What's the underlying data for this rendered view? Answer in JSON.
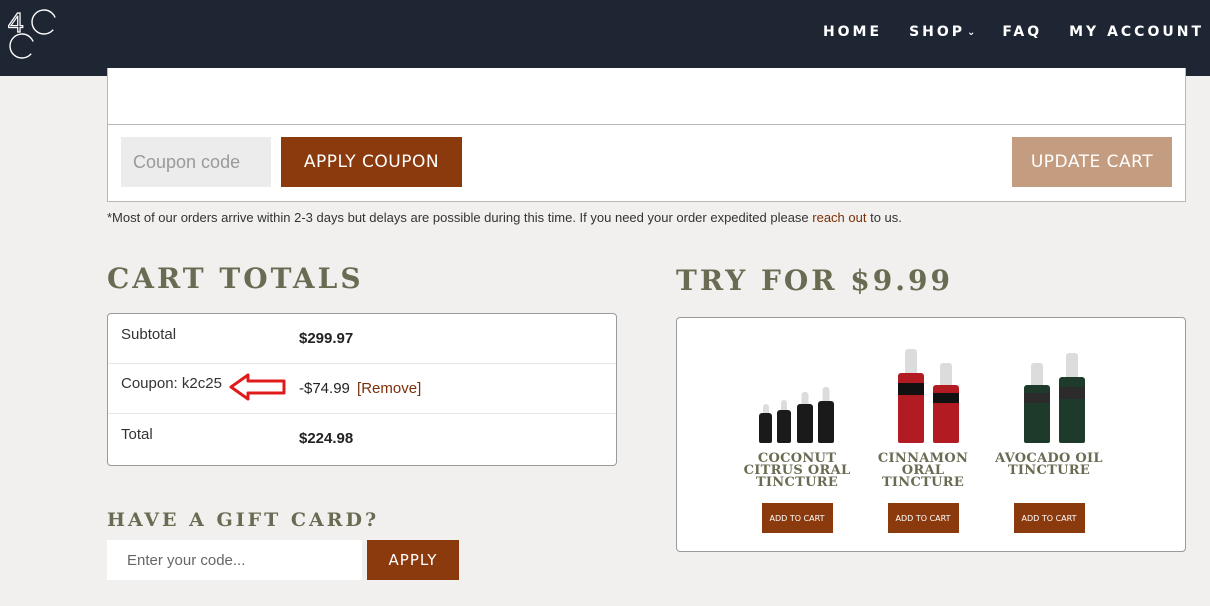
{
  "brand": {
    "logo_text": "4C"
  },
  "nav": {
    "home": "HOME",
    "shop": "SHOP",
    "faq": "FAQ",
    "account": "MY ACCOUNT"
  },
  "coupon": {
    "placeholder": "Coupon code",
    "apply_label": "APPLY COUPON",
    "update_label": "UPDATE CART"
  },
  "notice": {
    "text_before": "*Most of our orders arrive within 2-3 days but delays are possible during this time. If you need your order expedited please ",
    "link": "reach out",
    "text_after": " to us."
  },
  "cart_totals": {
    "heading": "CART TOTALS",
    "rows": [
      {
        "label": "Subtotal",
        "value": "$299.97"
      },
      {
        "label": "Coupon: k2c25",
        "value": "-$74.99",
        "action": "[Remove]"
      },
      {
        "label": "Total",
        "value": "$224.98"
      }
    ]
  },
  "gift_card": {
    "heading": "HAVE A GIFT CARD?",
    "placeholder": "Enter your code...",
    "apply_label": "APPLY"
  },
  "try_for": {
    "heading": "TRY FOR $9.99",
    "products": [
      {
        "name": "COCONUT CITRUS ORAL TINCTURE",
        "button": "ADD TO CART",
        "color": "#1a1a1a"
      },
      {
        "name": "CINNAMON ORAL TINCTURE",
        "button": "ADD TO CART",
        "color": "#b31b22"
      },
      {
        "name": "AVOCADO OIL TINCTURE",
        "button": "ADD TO CART",
        "color": "#1d3a2a"
      }
    ]
  },
  "colors": {
    "header_bg": "#1e2533",
    "accent_brown": "#8a3a0c",
    "update_button": "#c49c80",
    "heading_olive": "#6a6b52",
    "annotation_red": "#e01b1b"
  }
}
